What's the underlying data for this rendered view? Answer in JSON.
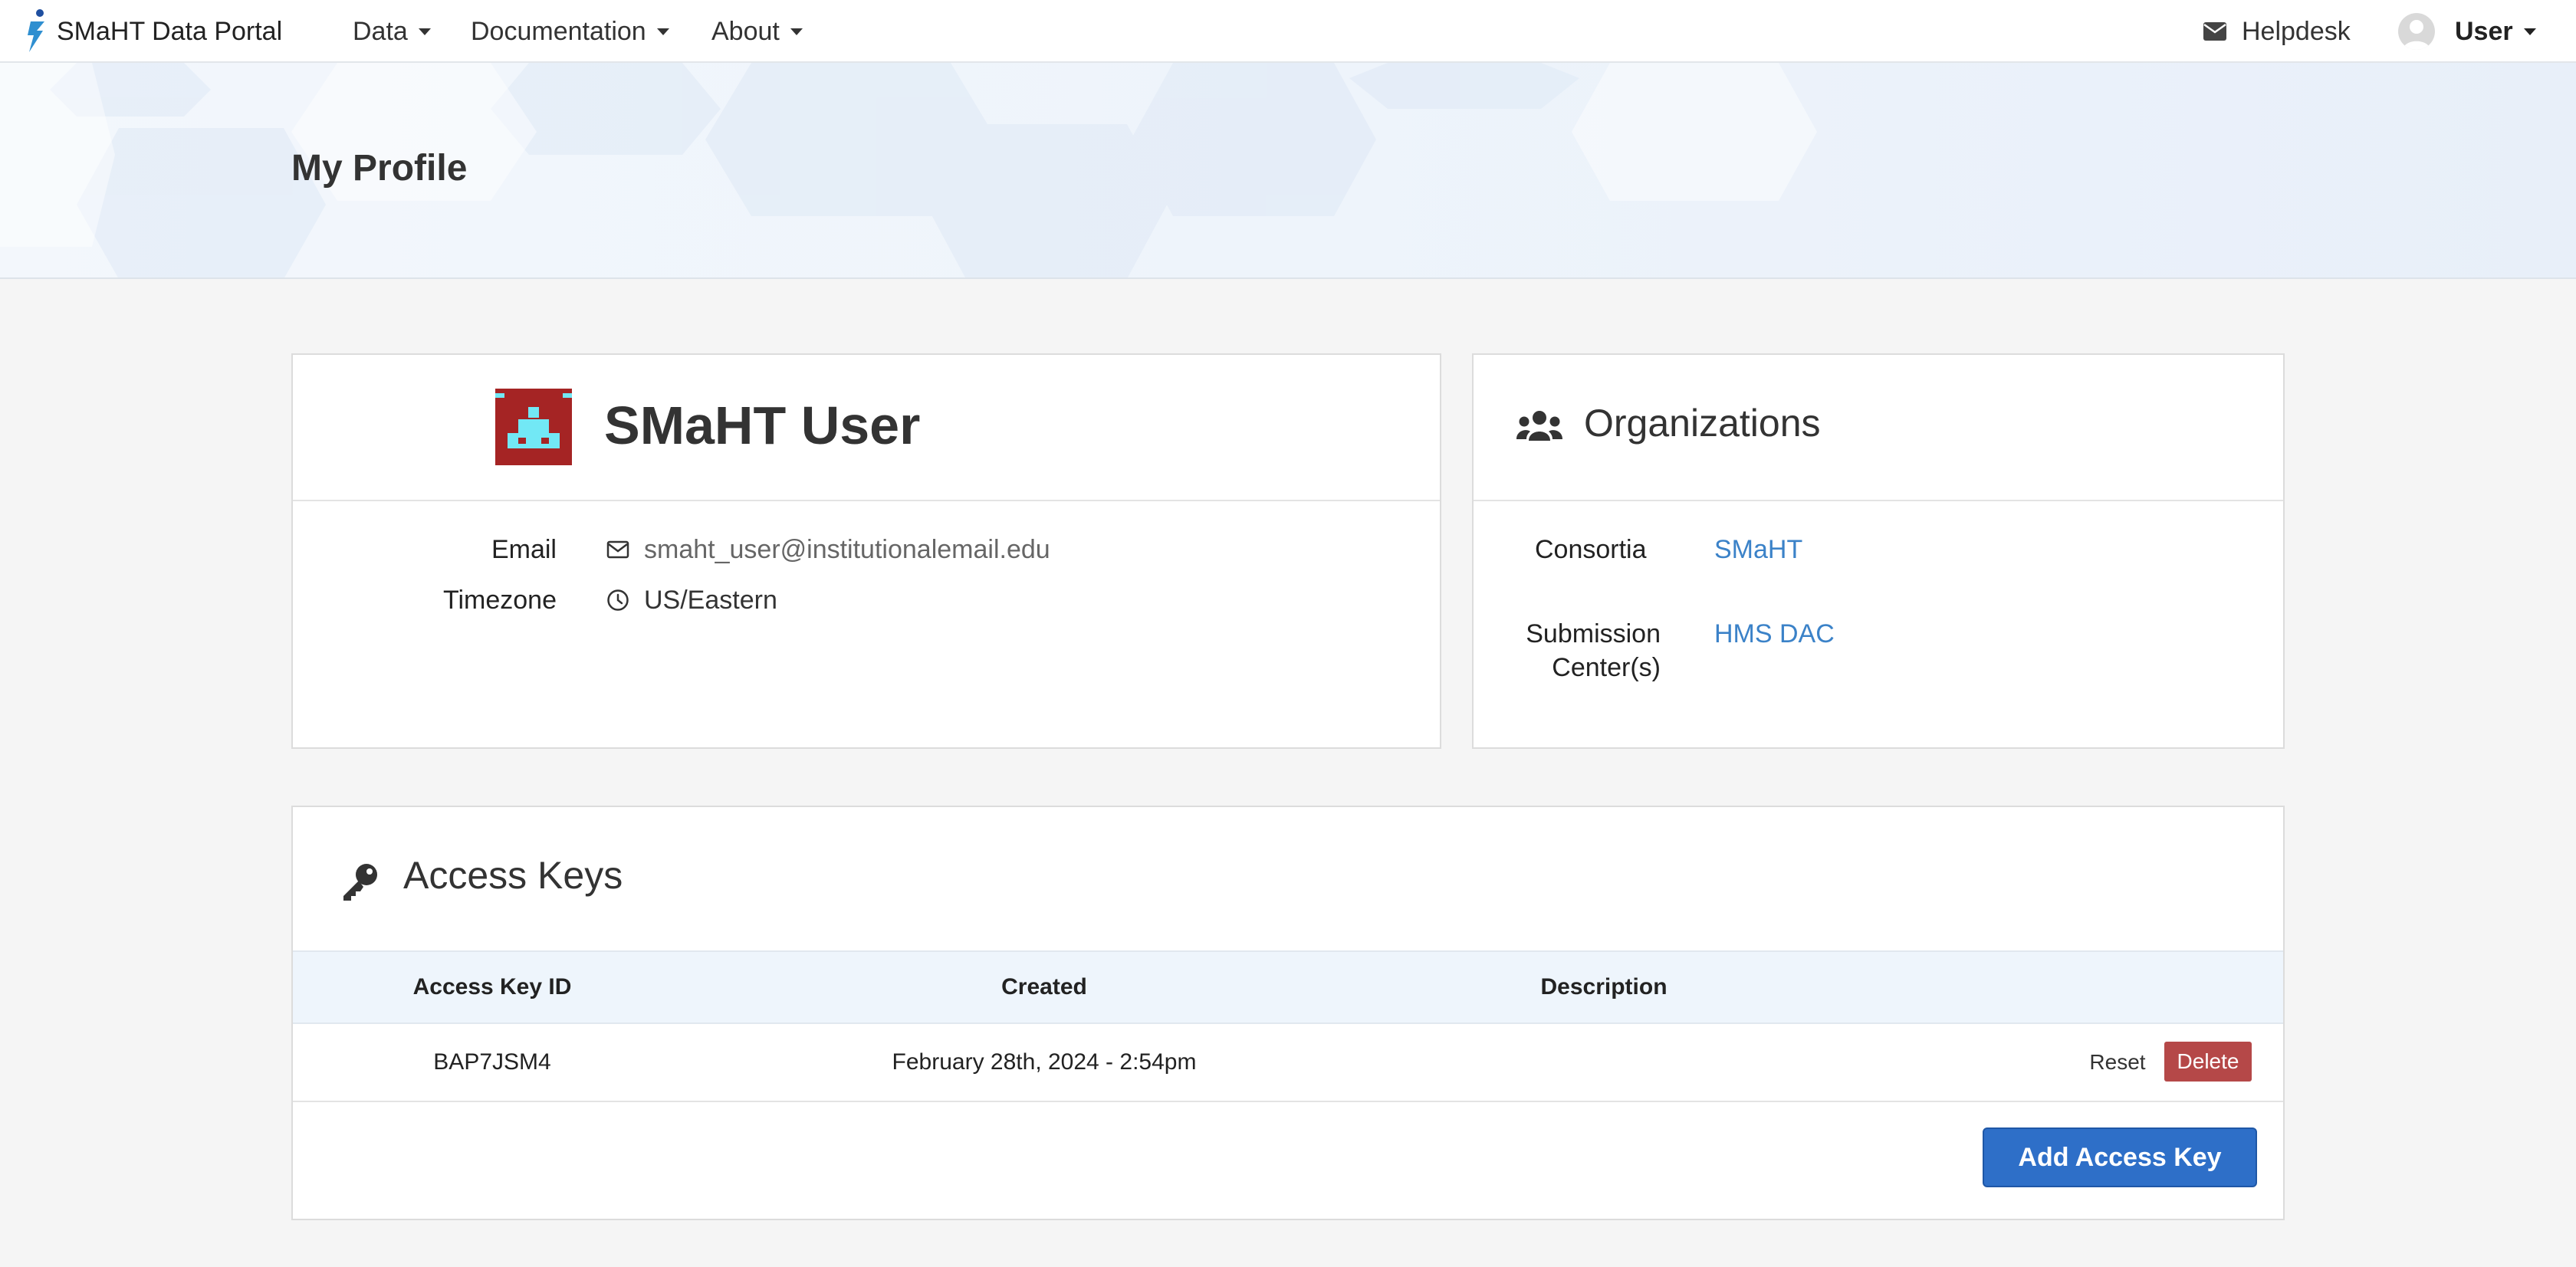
{
  "navbar": {
    "brand": "SMaHT Data Portal",
    "menu": [
      {
        "label": "Data"
      },
      {
        "label": "Documentation"
      },
      {
        "label": "About"
      }
    ],
    "helpdesk": "Helpdesk",
    "user": "User"
  },
  "page": {
    "title": "My Profile"
  },
  "profile": {
    "name": "SMaHT User",
    "email_label": "Email",
    "email": "smaht_user@institutionalemail.edu",
    "timezone_label": "Timezone",
    "timezone": "US/Eastern"
  },
  "organizations": {
    "title": "Organizations",
    "consortia_label": "Consortia",
    "consortia_value": "SMaHT",
    "submission_label_line1": "Submission",
    "submission_label_line2": "Center(s)",
    "submission_value": "HMS DAC"
  },
  "access_keys": {
    "title": "Access Keys",
    "columns": [
      "Access Key ID",
      "Created",
      "Description"
    ],
    "rows": [
      {
        "id": "BAP7JSM4",
        "created": "February 28th, 2024 - 2:54pm",
        "description": ""
      }
    ],
    "reset_label": "Reset",
    "delete_label": "Delete",
    "add_label": "Add Access Key"
  },
  "colors": {
    "link": "#3b82c8",
    "primary_button": "#2e6fc8",
    "danger_button": "#b54848",
    "table_header_bg": "#eef5fc"
  },
  "icons": {
    "helpdesk": "envelope-icon",
    "email": "envelope-outline-icon",
    "timezone": "clock-icon",
    "organizations": "users-icon",
    "access_keys": "key-icon"
  }
}
